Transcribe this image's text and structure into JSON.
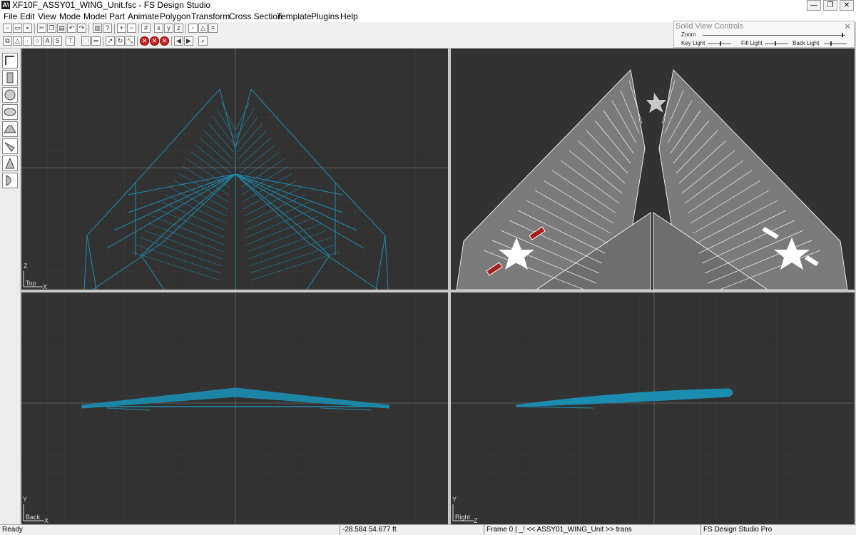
{
  "window": {
    "app_icon": "A\\",
    "title": "XF10F_ASSY01_WING_Unit.fsc - FS Design Studio",
    "minimize": "—",
    "restore": "❐",
    "close": "✕"
  },
  "menu": [
    "File",
    "Edit",
    "View",
    "Mode",
    "Model",
    "Part",
    "Animate",
    "Polygon",
    "Transform",
    "Cross Section",
    "Template",
    "Plugins",
    "Help"
  ],
  "solid_view_controls": {
    "title": "Solid View Controls",
    "close": "✕",
    "zoom": "Zoom",
    "key_light": "Key Light",
    "fill_light": "Fill Light",
    "back_light": "Back Light",
    "zoom_level": 0.98,
    "key_light_level": 0.55,
    "fill_light_level": 0.45,
    "back_light_level": 0.3
  },
  "viewports": {
    "top": {
      "axis_v": "Z",
      "name": "Top",
      "axis_h": "X"
    },
    "back": {
      "axis_v": "Y",
      "name": "Back",
      "axis_h": "X"
    },
    "right": {
      "axis_v": "Y",
      "name": "Right",
      "axis_h": "Z"
    }
  },
  "colors": {
    "wire": "#1a8db0",
    "solid": "#7b7b7b",
    "viewport_bg": "#323232",
    "grid": "#3b3b3b",
    "insignia_red": "#a61d1d"
  },
  "status": {
    "ready": "Ready",
    "coords": "-28.584   54.677 ft",
    "frame": "Frame 0 |  _! << ASSY01_WING_Unit >> trans",
    "app": "FS Design Studio Pro"
  }
}
